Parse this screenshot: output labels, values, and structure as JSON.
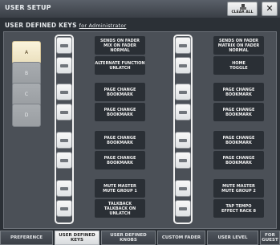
{
  "window": {
    "title": "USER SETUP",
    "clear_all_label": "CLEAR ALL",
    "close_label": "✕"
  },
  "header": {
    "section": "USER DEFINED KEYS",
    "for_label": "for Administrator"
  },
  "levels": [
    {
      "label": "A",
      "active": true
    },
    {
      "label": "B",
      "active": false
    },
    {
      "label": "C",
      "active": false
    },
    {
      "label": "D",
      "active": false
    }
  ],
  "keys_left": [
    {
      "line1": "SENDS ON FADER",
      "line2": "MIX ON FADER",
      "line3": "NORMAL"
    },
    {
      "line1": "ALTERNATE FUNCTION",
      "line2": "UNLATCH",
      "line3": ""
    },
    {
      "line1": "PAGE CHANGE",
      "line2": "BOOKMARK",
      "line3": ""
    },
    {
      "line1": "PAGE CHANGE",
      "line2": "BOOKMARK",
      "line3": ""
    },
    {
      "line1": "PAGE CHANGE",
      "line2": "BOOKMARK",
      "line3": ""
    },
    {
      "line1": "PAGE CHANGE",
      "line2": "BOOKMARK",
      "line3": ""
    },
    {
      "line1": "MUTE MASTER",
      "line2": "MUTE GROUP 1",
      "line3": ""
    },
    {
      "line1": "TALKBACK",
      "line2": "TALKBACK ON",
      "line3": "UNLATCH"
    }
  ],
  "keys_right": [
    {
      "line1": "SENDS ON FADER",
      "line2": "MATRIX ON FADER",
      "line3": "NORMAL"
    },
    {
      "line1": "HOME",
      "line2": "TOGGLE",
      "line3": ""
    },
    {
      "line1": "PAGE CHANGE",
      "line2": "BOOKMARK",
      "line3": ""
    },
    {
      "line1": "PAGE CHANGE",
      "line2": "BOOKMARK",
      "line3": ""
    },
    {
      "line1": "PAGE CHANGE",
      "line2": "BOOKMARK",
      "line3": ""
    },
    {
      "line1": "PAGE CHANGE",
      "line2": "BOOKMARK",
      "line3": ""
    },
    {
      "line1": "MUTE MASTER",
      "line2": "MUTE GROUP 2",
      "line3": ""
    },
    {
      "line1": "TAP TEMPO",
      "line2": "EFFECT RACK 8",
      "line3": ""
    }
  ],
  "tabs": [
    {
      "line1": "PREFERENCE",
      "line2": "",
      "active": false
    },
    {
      "line1": "USER DEFINED",
      "line2": "KEYS",
      "active": true
    },
    {
      "line1": "USER DEFINED",
      "line2": "KNOBS",
      "active": false
    },
    {
      "line1": "CUSTOM FADER",
      "line2": "",
      "active": false
    },
    {
      "line1": "USER LEVEL",
      "line2": "",
      "active": false
    },
    {
      "line1": "FOR",
      "line2": "GUEST",
      "active": false
    }
  ]
}
